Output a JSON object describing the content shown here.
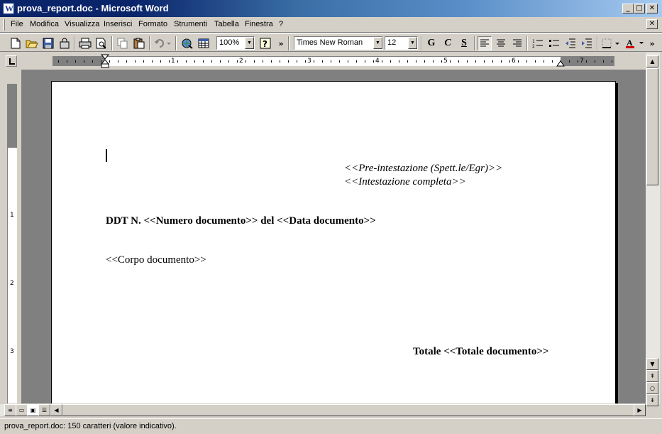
{
  "window": {
    "title": "prova_report.doc - Microsoft Word",
    "minimize": "_",
    "maximize": "□",
    "close": "✕"
  },
  "menu": {
    "items": [
      "File",
      "Modifica",
      "Visualizza",
      "Inserisci",
      "Formato",
      "Strumenti",
      "Tabella",
      "Finestra",
      "?"
    ],
    "close": "✕"
  },
  "toolbar": {
    "zoom": "100%",
    "font": "Times New Roman",
    "size": "12",
    "bold_label": "G",
    "italic_label": "C",
    "underline_label": "S",
    "more": "»"
  },
  "ruler": {
    "numbers": [
      "1",
      "2",
      "3",
      "4",
      "5",
      "6",
      "7"
    ]
  },
  "document": {
    "line1": "<<Pre-intestazione (Spett.le/Egr)>>",
    "line2": "<<Intestazione completa>>",
    "line3": "DDT N. <<Numero documento>> del <<Data documento>>",
    "line4": "<<Corpo documento>>",
    "line5": "Totale  <<Totale documento>>"
  },
  "status": {
    "text": "prova_report.doc: 150 caratteri (valore indicativo)."
  }
}
